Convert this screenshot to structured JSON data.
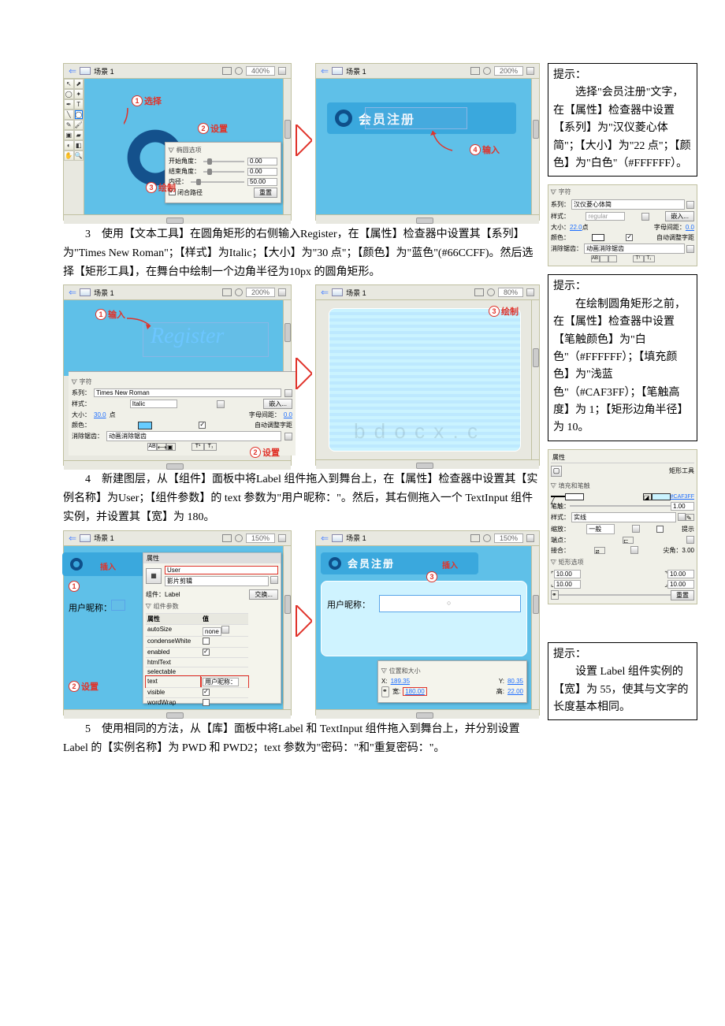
{
  "scene_label": "场景 1",
  "zoom": {
    "z400": "400%",
    "z200": "200%",
    "z150": "150%",
    "z80": "80%"
  },
  "tips": {
    "head": "提示：",
    "t1": "选择\"会员注册\"文字，在【属性】检查器中设置【系列】为\"汉仪菱心体简\"；【大小】为\"22 点\"；【颜色】为\"白色\"（#FFFFFF）。",
    "t2": "在绘制圆角矩形之前，在【属性】检查器中设置【笔触颜色】为\"白色\"（#FFFFFF）；【填充颜色】为\"浅蓝色\"（#CAF3FF）；【笔触高度】为 1；【矩形边角半径】为 10。",
    "t3": "设置 Label 组件实例的【宽】为 55，使其与文字的长度基本相同。"
  },
  "callouts": {
    "c1": "选择",
    "c2": "设置",
    "c3": "绘制",
    "c4": "输入",
    "in": "输入",
    "ins": "插入",
    "set": "设置",
    "draw": "绘制"
  },
  "paras": {
    "p3_num": "3",
    "p3": "使用【文本工具】在圆角矩形的右侧输入Register，在【属性】检查器中设置其【系列】为\"Times New Roman\"；【样式】为Italic；【大小】为\"30 点\"；【颜色】为\"蓝色\"(#66CCFF)。然后选择【矩形工具】，在舞台中绘制一个边角半径为10px 的圆角矩形。",
    "p4_num": "4",
    "p4": "新建图层，从【组件】面板中将Label 组件拖入到舞台上，在【属性】检查器中设置其【实例名称】为User；【组件参数】的 text 参数为\"用户昵称：\"。然后，其右侧拖入一个 TextInput 组件实例，并设置其【宽】为 180。",
    "p5_num": "5",
    "p5": "使用相同的方法，从【库】面板中将Label 和 TextInput 组件拖入到舞台上，并分别设置Label 的【实例名称】为 PWD 和 PWD2；text 参数为\"密码：\"和\"重复密码：\"。"
  },
  "cn_title": "会员注册",
  "register": "Register",
  "user_label": "用户昵称：",
  "subpanel": {
    "title": "▽ 椭圆选项",
    "start": "开始角度：",
    "end": "结束角度：",
    "inner": "内径：",
    "close": "闭合路径",
    "reset": "重置",
    "v0": "0.00",
    "v50": "50.00"
  },
  "char": {
    "title": "▽ 字符",
    "series": "系列：",
    "style": "样式：",
    "size": "大小：",
    "spacing": "字母间距：",
    "color": "颜色：",
    "auto": "自动调整字距",
    "aa": "消除锯齿：",
    "aa_val": "动画消除锯齿",
    "tnr": "Times New Roman",
    "italic": "Italic",
    "embed": "嵌入...",
    "s30": "30.0",
    "s22": "22.0",
    "sp0": "0.0",
    "hy": "汉仪菱心体简",
    "reg": "regular",
    "pt": "点"
  },
  "rect": {
    "tool": "矩形工具",
    "fs": "▽ 填充和笔触",
    "stroke": "笔触：",
    "style_l": "样式：",
    "style_v": "实线",
    "scale_l": "缩放：",
    "scale_v": "一般",
    "hint": "提示",
    "cap": "端点：",
    "join": "接合：",
    "jv": "尖角：3.00",
    "ro": "▽ 矩形选项",
    "r10": "10.00",
    "reset": "重置",
    "fc": "#CAF3FF",
    "one": "1.00"
  },
  "prop": {
    "head": "属性",
    "inst": "User",
    "disp": "影片剪辑",
    "comp": "组件：Label",
    "swap": "交换...",
    "params": "▽ 组件参数",
    "attr": "属性",
    "val": "值",
    "autoSize": "autoSize",
    "none": "none",
    "cw": "condenseWhite",
    "en": "enabled",
    "ht": "htmlText",
    "sel": "selectable",
    "text": "text",
    "tv": "用户昵称：",
    "vis": "visible",
    "ww": "wordWrap"
  },
  "pos": {
    "head": "▽ 位置和大小",
    "x": "X:",
    "xv": "189.35",
    "y": "Y:",
    "yv": "80.35",
    "w": "宽:",
    "wv": "180.00",
    "h": "高:",
    "hv": "22.00"
  },
  "mini_props": "属性"
}
